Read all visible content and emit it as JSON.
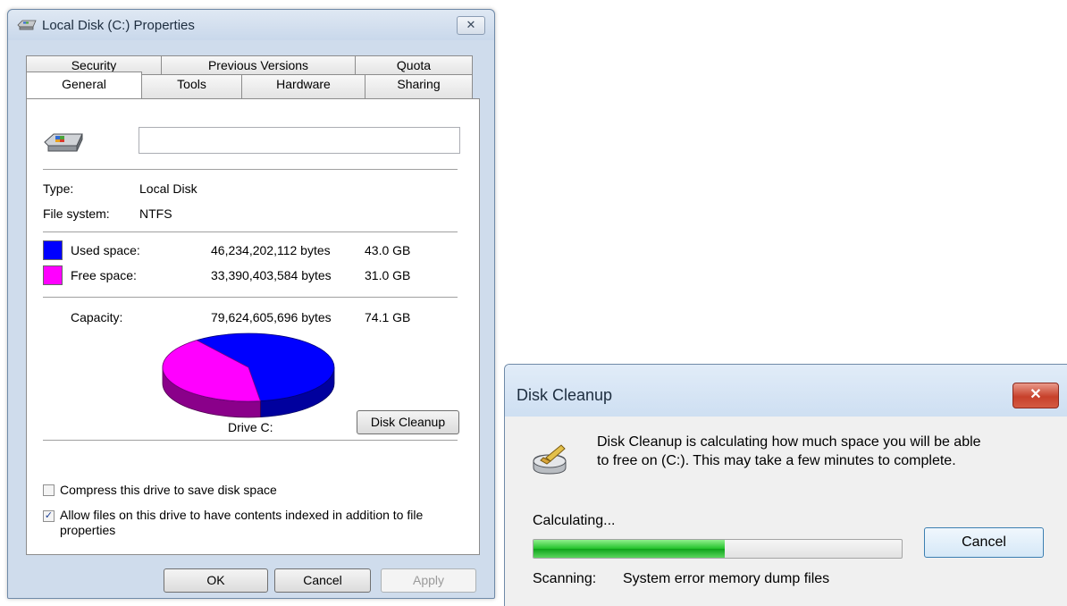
{
  "properties_window": {
    "title": "Local Disk (C:) Properties",
    "tabs_back": [
      "Security",
      "Previous Versions",
      "Quota"
    ],
    "tabs_front": [
      "General",
      "Tools",
      "Hardware",
      "Sharing"
    ],
    "active_tab": "General",
    "drive_label_value": "",
    "type_label": "Type:",
    "type_value": "Local Disk",
    "fs_label": "File system:",
    "fs_value": "NTFS",
    "used_label": "Used space:",
    "used_bytes": "46,234,202,112 bytes",
    "used_gb": "43.0 GB",
    "free_label": "Free space:",
    "free_bytes": "33,390,403,584 bytes",
    "free_gb": "31.0 GB",
    "capacity_label": "Capacity:",
    "capacity_bytes": "79,624,605,696 bytes",
    "capacity_gb": "74.1 GB",
    "used_fraction": 0.5807,
    "drive_caption": "Drive C:",
    "disk_cleanup_button": "Disk Cleanup",
    "compress_label": "Compress this drive to save disk space",
    "compress_checked": false,
    "index_label_line1": "Allow files on this drive to have contents indexed in addition to file",
    "index_label_line2": "properties",
    "index_checked": true,
    "ok_button": "OK",
    "cancel_button": "Cancel",
    "apply_button": "Apply",
    "colors": {
      "used": "#0000ff",
      "free": "#ff00ff"
    }
  },
  "disk_cleanup_window": {
    "title": "Disk Cleanup",
    "message_line1": "Disk Cleanup is calculating how much space you will be able",
    "message_line2": "to free on  (C:). This may take a few minutes to complete.",
    "calculating_label": "Calculating...",
    "progress_fraction": 0.52,
    "cancel_button": "Cancel",
    "scanning_label": "Scanning:",
    "scanning_value": "System error memory dump files"
  },
  "icons": [
    "drive-icon",
    "close-icon",
    "cleanup-drive-icon",
    "checkmark-icon"
  ]
}
